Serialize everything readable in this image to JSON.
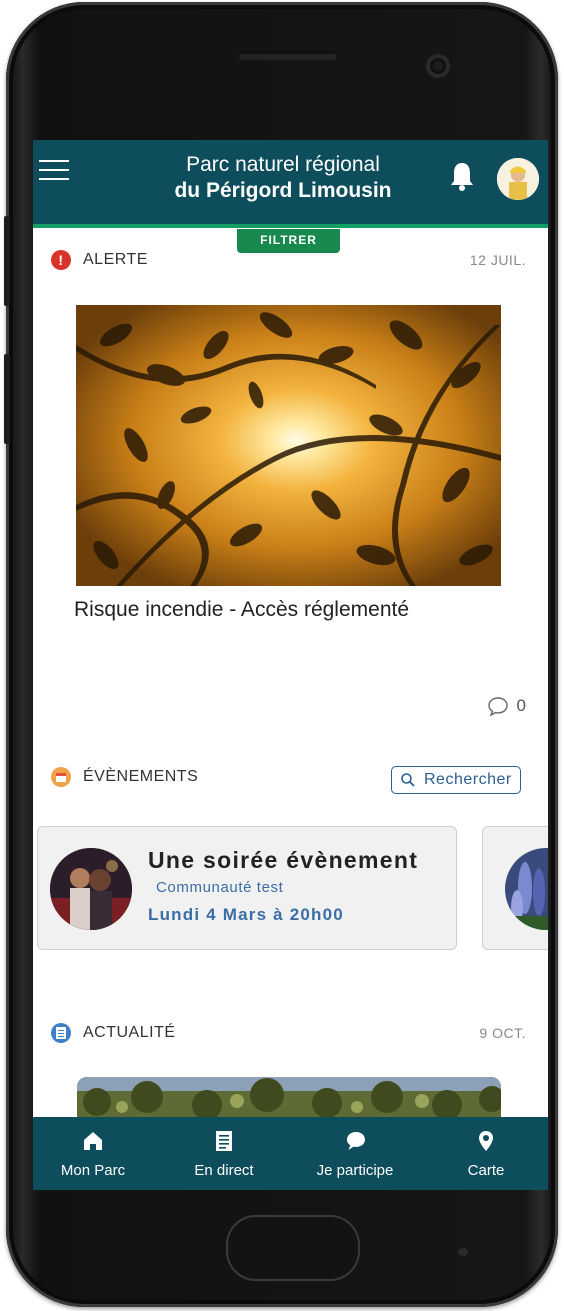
{
  "header": {
    "title_line1": "Parc naturel régional",
    "title_line2": "du Périgord Limousin",
    "filter_label": "FILTRER"
  },
  "alert": {
    "category": "ALERTE",
    "date": "12 JUIL.",
    "title": "Risque incendie - Accès réglementé",
    "comment_count": "0",
    "icon": "exclamation-icon",
    "icon_color": "#d9342b"
  },
  "events": {
    "category": "ÉVÈNEMENTS",
    "search_label": "Rechercher",
    "icon_color": "#f0a14a",
    "card": {
      "title": "Une soirée évènement",
      "community": "Communauté test",
      "date": "Lundi 4 Mars à 20h00"
    }
  },
  "news": {
    "category": "ACTUALITÉ",
    "date": "9 OCT.",
    "icon_color": "#3f7ec8"
  },
  "tabs": [
    {
      "label": "Mon Parc",
      "icon": "home-icon"
    },
    {
      "label": "En direct",
      "icon": "document-icon"
    },
    {
      "label": "Je participe",
      "icon": "chat-icon"
    },
    {
      "label": "Carte",
      "icon": "map-pin-icon"
    }
  ],
  "colors": {
    "header_bg": "#0e4d5b",
    "accent_green": "#17894e",
    "link_blue": "#3b6ea5"
  }
}
